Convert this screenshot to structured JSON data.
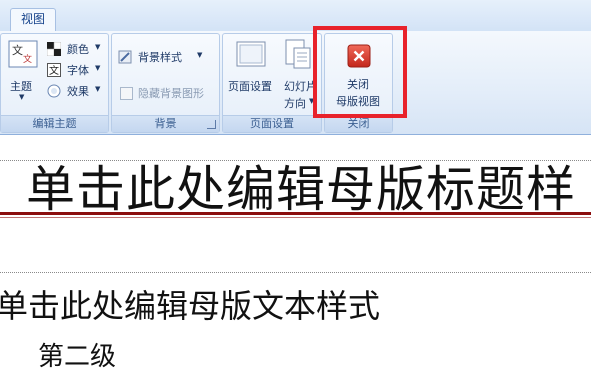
{
  "ribbon": {
    "tab_label": "视图",
    "groups": {
      "edit_theme": {
        "label": "编辑主题",
        "theme_label": "主题",
        "colors_label": "颜色",
        "fonts_label": "字体",
        "effects_label": "效果",
        "theme_icon_text": "文文"
      },
      "background": {
        "label": "背景",
        "style_label": "背景样式",
        "hide_label": "隐藏背景图形"
      },
      "page_setup": {
        "label": "页面设置",
        "setup_label": "页面设置",
        "orientation_line1": "幻灯片",
        "orientation_line2": "方向"
      },
      "close": {
        "label": "关闭",
        "close_line1": "关闭",
        "close_line2": "母版视图"
      }
    }
  },
  "slide": {
    "title_placeholder": "单击此处编辑母版标题样",
    "body_placeholder": "单击此处编辑母版文本样式",
    "level2_placeholder": "第二级"
  },
  "colors": {
    "accent_red": "#e8222b",
    "title_underline": "#8b0d0d",
    "ribbon_text": "#1f3a67"
  },
  "icons": [
    "theme-icon",
    "colors-icon",
    "fonts-icon",
    "effects-icon",
    "background-style-icon",
    "page-setup-icon",
    "slide-orientation-icon",
    "close-master-view-icon"
  ]
}
